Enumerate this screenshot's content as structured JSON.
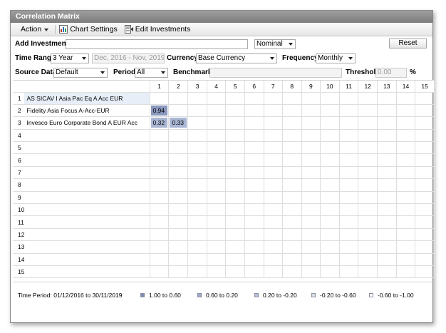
{
  "window": {
    "title": "Correlation Matrix"
  },
  "toolbar": {
    "action_label": "Action",
    "chart_settings_label": "Chart Settings",
    "edit_investments_label": "Edit Investments"
  },
  "add_investment": {
    "label": "Add Investment",
    "value": "",
    "return_type": "Nominal",
    "reset_label": "Reset"
  },
  "time_range": {
    "label": "Time Range",
    "value": "3 Year",
    "date_range": "Dec, 2016 - Nov, 2019"
  },
  "currency": {
    "label": "Currency",
    "value": "Base Currency"
  },
  "frequency": {
    "label": "Frequency",
    "value": "Monthly"
  },
  "source_data": {
    "label": "Source Data",
    "value": "Default"
  },
  "period": {
    "label": "Period",
    "value": "All"
  },
  "benchmark": {
    "label": "Benchmark",
    "value": ""
  },
  "threshold": {
    "label": "Threshold",
    "value": "0.00",
    "unit": "%"
  },
  "matrix": {
    "columns": [
      "1",
      "2",
      "3",
      "4",
      "5",
      "6",
      "7",
      "8",
      "9",
      "10",
      "11",
      "12",
      "13",
      "14",
      "15"
    ],
    "rows": [
      {
        "num": "1",
        "name": "AS SICAV I Asia Pac Eq A Acc EUR",
        "values": []
      },
      {
        "num": "2",
        "name": "Fidelity Asia Focus A-Acc-EUR",
        "values": [
          "0.94"
        ]
      },
      {
        "num": "3",
        "name": "Invesco Euro Corporate Bond A EUR Acc",
        "values": [
          "0.32",
          "0.33"
        ]
      },
      {
        "num": "4",
        "name": "",
        "values": []
      },
      {
        "num": "5",
        "name": "",
        "values": []
      },
      {
        "num": "6",
        "name": "",
        "values": []
      },
      {
        "num": "7",
        "name": "",
        "values": []
      },
      {
        "num": "8",
        "name": "",
        "values": []
      },
      {
        "num": "9",
        "name": "",
        "values": []
      },
      {
        "num": "10",
        "name": "",
        "values": []
      },
      {
        "num": "11",
        "name": "",
        "values": []
      },
      {
        "num": "12",
        "name": "",
        "values": []
      },
      {
        "num": "13",
        "name": "",
        "values": []
      },
      {
        "num": "14",
        "name": "",
        "values": []
      },
      {
        "num": "15",
        "name": "",
        "values": []
      }
    ]
  },
  "footer": {
    "time_period": "Time Period: 01/12/2016 to 30/11/2019",
    "legend": [
      {
        "label": "1.00 to 0.60",
        "color": "#7f8db3"
      },
      {
        "label": "0.60 to 0.20",
        "color": "#9fabc7"
      },
      {
        "label": "0.20 to -0.20",
        "color": "#b7c0d6"
      },
      {
        "label": "-0.20 to -0.60",
        "color": "#d9dde8"
      },
      {
        "label": "-0.60 to -1.00",
        "color": "#ffffff"
      }
    ]
  },
  "colors": {
    "strong_cell": "#8a98be",
    "medium_cell": "#a9b6d3",
    "selected_row": "#e7eef8"
  }
}
